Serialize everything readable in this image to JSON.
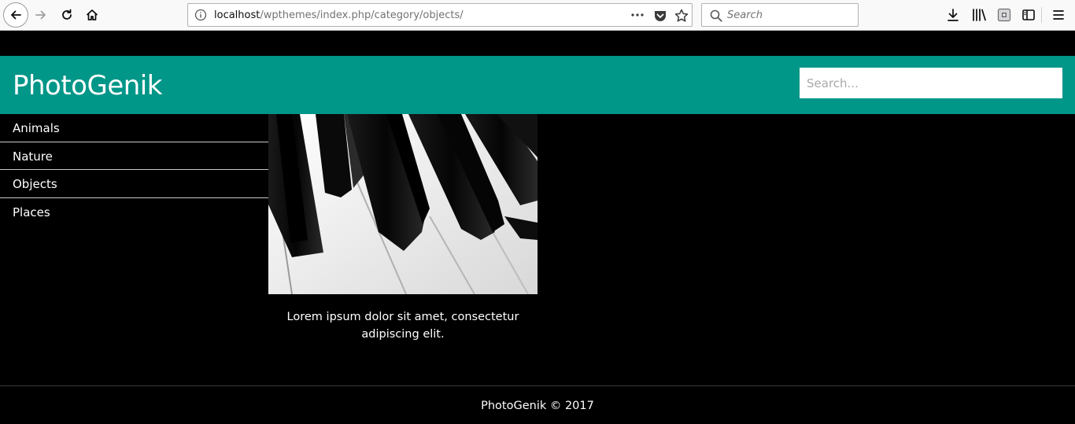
{
  "browser": {
    "url_host": "localhost",
    "url_path": "/wpthemes/index.php/category/objects/",
    "search_placeholder": "Search",
    "icons": [
      "back-icon",
      "forward-icon",
      "reload-icon",
      "home-icon",
      "info-icon",
      "more-icon",
      "pocket-icon",
      "bookmark-star-icon",
      "search-icon",
      "download-icon",
      "library-icon",
      "extension-icon",
      "sidebar-icon",
      "hamburger-menu-icon"
    ]
  },
  "site": {
    "title": "PhotoGenik",
    "search_placeholder": "Search...",
    "accent_color": "#009688",
    "background_color": "#000000"
  },
  "nav": {
    "items": [
      {
        "label": "Animals"
      },
      {
        "label": "Nature"
      },
      {
        "label": "Objects"
      },
      {
        "label": "Places"
      }
    ]
  },
  "post": {
    "image_subject": "piano keys",
    "excerpt": "Lorem ipsum dolor sit amet, consectetur adipiscing elit."
  },
  "footer": {
    "text": "PhotoGenik © 2017"
  }
}
